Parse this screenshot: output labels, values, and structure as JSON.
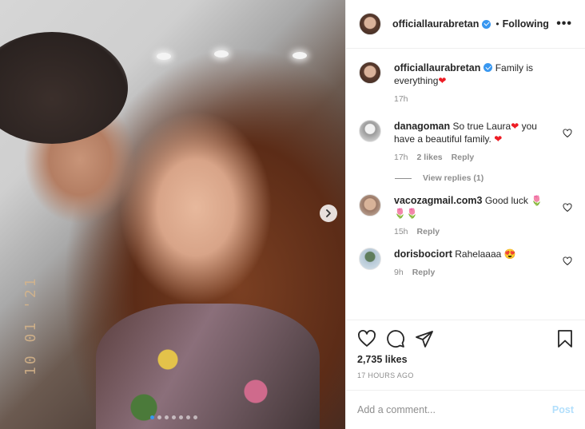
{
  "post": {
    "date_stamp": "10 01 '21",
    "carousel_count": 7,
    "carousel_active": 0
  },
  "header": {
    "username": "officiallaurabretan",
    "separator": "•",
    "follow_state": "Following",
    "more_label": "•••"
  },
  "caption": {
    "username": "officiallaurabretan",
    "text": "Family is everything",
    "emoji": "❤",
    "time": "17h"
  },
  "comments": [
    {
      "username": "danagoman",
      "text": "So true Laura",
      "emoji_after_text": "❤",
      "text2": "you have a beautiful family.",
      "emoji_end": "❤",
      "time": "17h",
      "likes": "2 likes",
      "reply": "Reply"
    },
    {
      "username": "vacozagmail.com3",
      "text": "Good luck",
      "emoji_end": "🌷 🌷🌷",
      "time": "15h",
      "reply": "Reply"
    },
    {
      "username": "dorisbociort",
      "text": "Rahelaaaa",
      "emoji_end": "😍",
      "time": "9h",
      "reply": "Reply"
    }
  ],
  "view_replies": "View replies (1)",
  "stats": {
    "likes": "2,735 likes",
    "time_ago": "17 HOURS AGO"
  },
  "add_comment": {
    "placeholder": "Add a comment...",
    "post_label": "Post"
  },
  "colors": {
    "verified_blue": "#3897f0",
    "post_button_disabled": "#b2dffc",
    "secondary_text": "#8e8e8e"
  }
}
